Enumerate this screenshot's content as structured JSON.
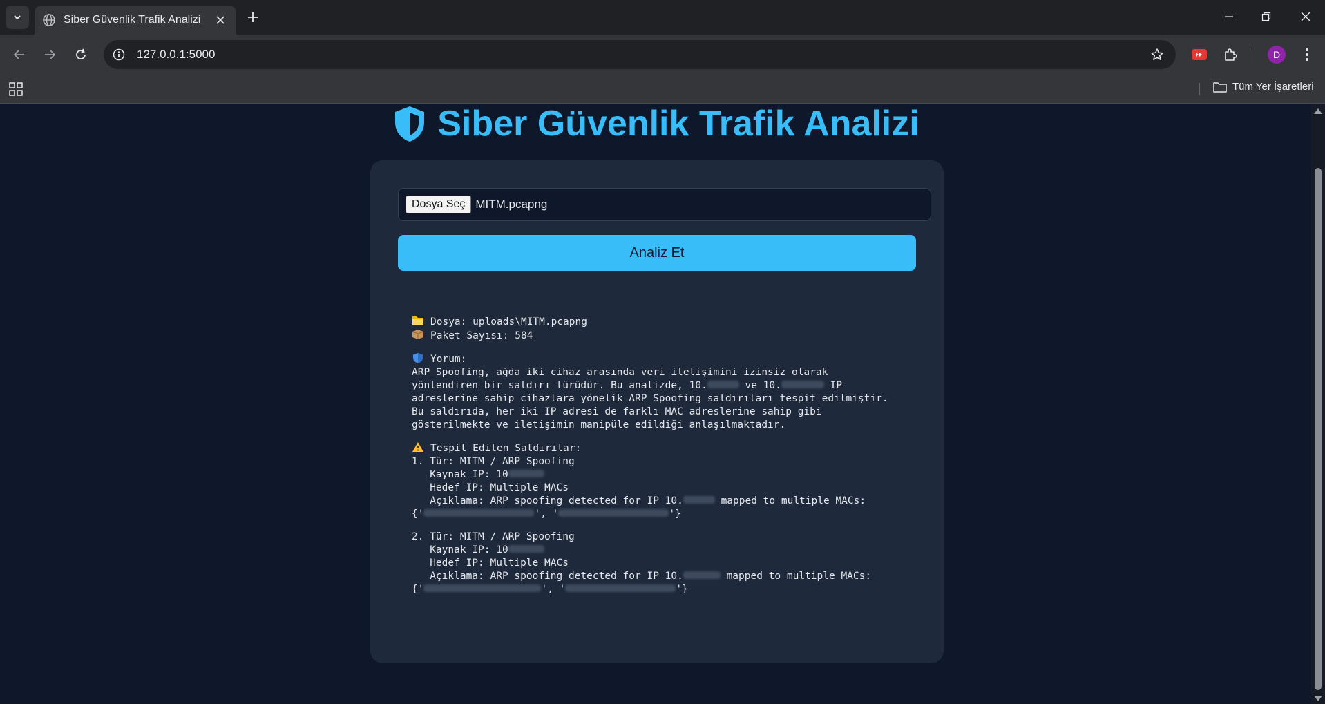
{
  "browser": {
    "tab_title": "Siber Güvenlik Trafik Analizi",
    "url": "127.0.0.1:5000",
    "profile_initial": "D",
    "bookmarks_all_label": "Tüm Yer İşaretleri"
  },
  "page": {
    "title": "Siber Güvenlik Trafik Analizi",
    "file_button_label": "Dosya Seç",
    "file_name": "MITM.pcapng",
    "analyze_button_label": "Analiz Et"
  },
  "result": {
    "file_line": "Dosya: uploads\\MITM.pcapng",
    "packet_line": "Paket Sayısı: 584",
    "comment_label": "Yorum:",
    "comment_lines": [
      "ARP Spoofing, ağda iki cihaz arasında veri iletişimini izinsiz olarak",
      "yönlendiren bir saldırı türüdür. Bu analizde, 10.",
      "ve 10.",
      "IP",
      "adreslerine sahip cihazlara yönelik ARP Spoofing saldırıları tespit edilmiştir.",
      "Bu saldırıda, her iki IP adresi de farklı MAC adreslerine sahip gibi",
      "gösterilmekte ve iletişimin manipüle edildiği anlaşılmaktadır."
    ],
    "attacks_label": "Tespit Edilen Saldırılar:",
    "attacks": [
      {
        "type_line": "1. Tür: MITM / ARP Spoofing",
        "source_prefix": "   Kaynak IP: 10",
        "target_line": "   Hedef IP: Multiple MACs",
        "desc_prefix": "   Açıklama: ARP spoofing detected for IP 10.",
        "desc_suffix": " mapped to multiple MACs:",
        "macs_open": "{'",
        "macs_mid": "', '",
        "macs_close": "'}"
      },
      {
        "type_line": "2. Tür: MITM / ARP Spoofing",
        "source_prefix": "   Kaynak IP: 10",
        "target_line": "   Hedef IP: Multiple MACs",
        "desc_prefix": "   Açıklama: ARP spoofing detected for IP 10.",
        "desc_suffix": " mapped to multiple MACs:",
        "macs_open": "{'",
        "macs_mid": "', '",
        "macs_close": "'}"
      }
    ]
  },
  "colors": {
    "accent": "#38bdf8",
    "page_bg": "#0f172a",
    "card_bg": "#1e293b"
  }
}
